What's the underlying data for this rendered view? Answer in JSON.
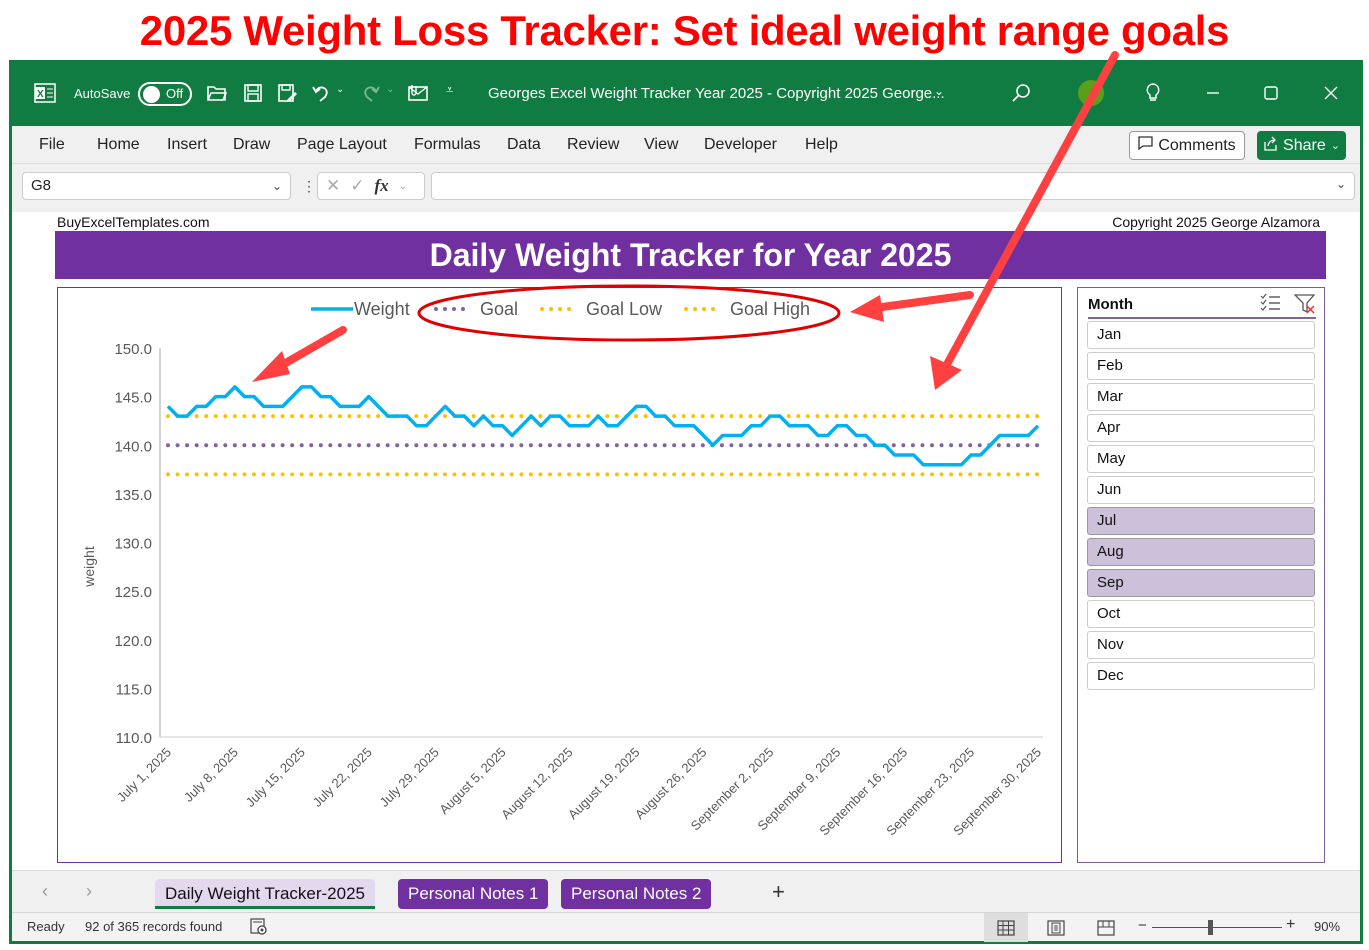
{
  "banner": {
    "text": "2025 Weight Loss Tracker: Set ideal weight range goals"
  },
  "titlebar": {
    "autosave_label": "AutoSave",
    "autosave_state": "Off",
    "doc_title": "Georges Excel Weight Tracker Year 2025 - Copyright 2025 George...",
    "icons": [
      "excel-logo-icon",
      "open-folder-icon",
      "save-icon",
      "save-as-icon",
      "undo-icon",
      "redo-icon",
      "email-attach-icon",
      "customize-toolbar-icon",
      "search-icon",
      "copilot-icon",
      "lightbulb-icon",
      "minimize-icon",
      "maximize-icon",
      "close-icon"
    ]
  },
  "ribbon": {
    "tabs": [
      "File",
      "Home",
      "Insert",
      "Draw",
      "Page Layout",
      "Formulas",
      "Data",
      "Review",
      "View",
      "Developer",
      "Help"
    ],
    "comments_label": "Comments",
    "share_label": "Share"
  },
  "formula_bar": {
    "name_box": "G8",
    "fx_label": "fx",
    "formula": ""
  },
  "sheet": {
    "site_label": "BuyExcelTemplates.com",
    "copyright_label": "Copyright 2025  George Alzamora",
    "title": "Daily Weight Tracker for Year 2025"
  },
  "slicer": {
    "title": "Month",
    "items": [
      {
        "label": "Jan",
        "selected": false
      },
      {
        "label": "Feb",
        "selected": false
      },
      {
        "label": "Mar",
        "selected": false
      },
      {
        "label": "Apr",
        "selected": false
      },
      {
        "label": "May",
        "selected": false
      },
      {
        "label": "Jun",
        "selected": false
      },
      {
        "label": "Jul",
        "selected": true
      },
      {
        "label": "Aug",
        "selected": true
      },
      {
        "label": "Sep",
        "selected": true
      },
      {
        "label": "Oct",
        "selected": false
      },
      {
        "label": "Nov",
        "selected": false
      },
      {
        "label": "Dec",
        "selected": false
      }
    ]
  },
  "sheet_tabs": {
    "tabs": [
      "Daily Weight Tracker-2025",
      "Personal Notes 1",
      "Personal Notes 2"
    ],
    "active": 0,
    "add_label": "+"
  },
  "status_bar": {
    "ready": "Ready",
    "records": "92 of 365 records found",
    "zoom": "90%",
    "zoom_minus": "−",
    "zoom_plus": "+"
  },
  "colors": {
    "excel_green": "#107c41",
    "purple": "#7030a0",
    "weight_line": "#00b0f0",
    "goal_line": "#8064a2",
    "goal_range_line": "#ffc000",
    "slicer_selected": "#ccc0da",
    "annotation_red": "#ff4040"
  },
  "chart_data": {
    "type": "line",
    "title": "",
    "xlabel": "",
    "ylabel": "weight",
    "ylim": [
      110,
      150
    ],
    "ytick_step": 5,
    "yticks": [
      "150.0",
      "145.0",
      "140.0",
      "135.0",
      "130.0",
      "125.0",
      "120.0",
      "115.0",
      "110.0"
    ],
    "x_start": "July 1, 2025",
    "x_end": "September 30, 2025",
    "xtick_labels": [
      "July 1, 2025",
      "July 8, 2025",
      "July 15, 2025",
      "July 22, 2025",
      "July 29, 2025",
      "August 5, 2025",
      "August 12, 2025",
      "August 19, 2025",
      "August 26, 2025",
      "September 2, 2025",
      "September 9, 2025",
      "September 16, 2025",
      "September 23, 2025",
      "September 30, 2025"
    ],
    "xtick_every_days": 7,
    "legend": [
      "Weight",
      "Goal",
      "Goal Low",
      "Goal High"
    ],
    "legend_position": "top",
    "grid": false,
    "series": [
      {
        "name": "Weight",
        "style": "solid",
        "values": [
          144,
          143,
          143,
          144,
          144,
          145,
          145,
          146,
          145,
          145,
          144,
          144,
          144,
          145,
          146,
          146,
          145,
          145,
          144,
          144,
          144,
          145,
          144,
          143,
          143,
          143,
          142,
          142,
          143,
          144,
          143,
          143,
          142,
          143,
          142,
          142,
          141,
          142,
          143,
          142,
          143,
          143,
          142,
          142,
          142,
          143,
          142,
          142,
          143,
          144,
          144,
          143,
          143,
          142,
          142,
          142,
          141,
          140,
          141,
          141,
          141,
          142,
          142,
          143,
          143,
          142,
          142,
          142,
          141,
          141,
          142,
          142,
          141,
          141,
          140,
          140,
          139,
          139,
          139,
          138,
          138,
          138,
          138,
          138,
          139,
          139,
          140,
          141,
          141,
          141,
          141,
          142
        ]
      },
      {
        "name": "Goal",
        "style": "dotted",
        "constant": 140
      },
      {
        "name": "Goal Low",
        "style": "dotted",
        "constant": 137
      },
      {
        "name": "Goal High",
        "style": "dotted",
        "constant": 143
      }
    ]
  }
}
